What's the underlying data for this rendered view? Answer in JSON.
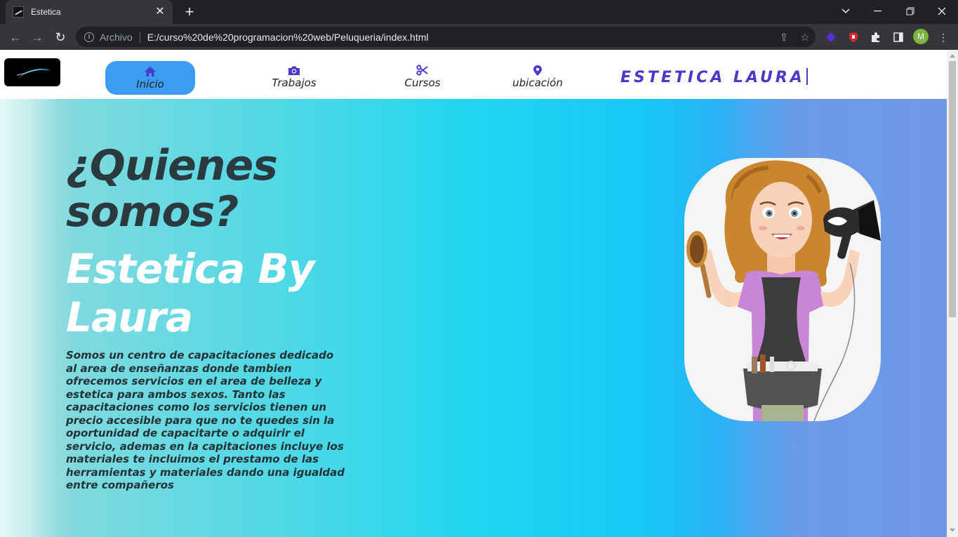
{
  "browser": {
    "tab_title": "Estetica",
    "scheme_label": "Archivo",
    "url": "E:/curso%20de%20programacion%20web/Peluqueria/index.html",
    "profile_initial": "M"
  },
  "site": {
    "nav": [
      {
        "label": "Inicio",
        "icon": "home-icon",
        "active": true
      },
      {
        "label": "Trabajos",
        "icon": "camera-icon",
        "active": false
      },
      {
        "label": "Cursos",
        "icon": "scissors-icon",
        "active": false
      },
      {
        "label": "ubicación",
        "icon": "location-pin-icon",
        "active": false
      }
    ],
    "brand": "ESTETICA LAURA"
  },
  "hero": {
    "title": "¿Quienes somos?",
    "subtitle": "Estetica By Laura",
    "text": "Somos un centro de capacitaciones dedicado al area de enseñanzas donde tambien ofrecemos servicios en el area de belleza y estetica para ambos sexos. Tanto las capacitaciones como los servicios tienen un precio accesible para que no te quedes sin la oportunidad de capacitarte o adquirir el servicio, ademas en la capitaciones incluye los materiales te incluimos el prestamo de las herramientas y materiales dando una igualdad entre compañeros"
  },
  "colors": {
    "nav_active": "#3c9cf2",
    "brand": "#4b39cc",
    "icon": "#4b39cc"
  }
}
